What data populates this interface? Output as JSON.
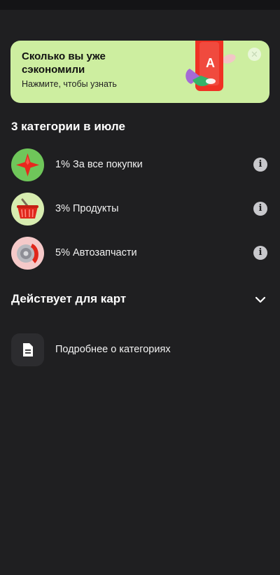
{
  "promo": {
    "title": "Сколько вы уже сэкономили",
    "subtitle": "Нажмите, чтобы узнать",
    "close_icon": "close-icon",
    "phone_logo": "А"
  },
  "categories": {
    "title": "3 категории в июле",
    "items": [
      {
        "label": "1% За все покупки",
        "icon": "star-icon",
        "icon_bg": "#6fc65a",
        "info_icon": "info-icon"
      },
      {
        "label": "3% Продукты",
        "icon": "basket-icon",
        "icon_bg": "#d7ecb0",
        "info_icon": "info-icon"
      },
      {
        "label": "5% Автозапчасти",
        "icon": "brake-disc-icon",
        "icon_bg": "#f5c9c9",
        "info_icon": "info-icon"
      }
    ]
  },
  "cards": {
    "title": "Действует для карт",
    "toggle_icon": "chevron-down-icon"
  },
  "more": {
    "label": "Подробнее о категориях",
    "icon": "document-icon"
  },
  "colors": {
    "background": "#1f1f21",
    "promo_bg": "#cdeea0",
    "brand_red": "#ef3124"
  }
}
